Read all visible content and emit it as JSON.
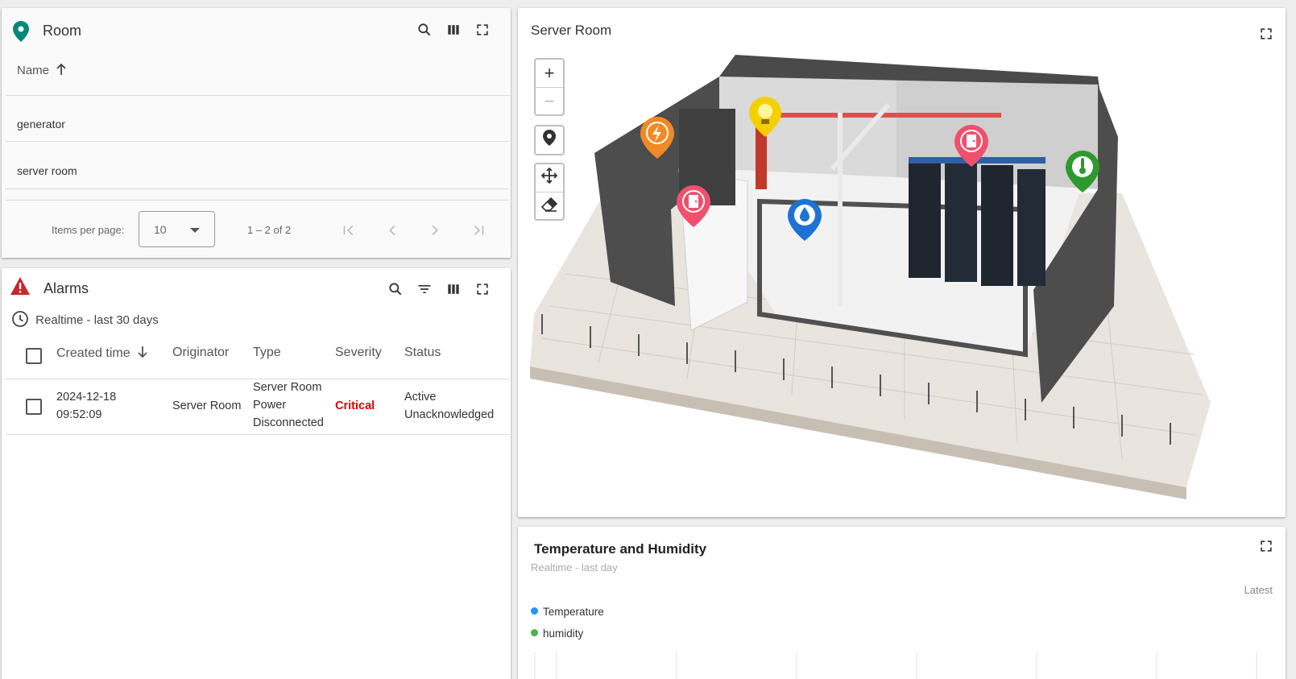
{
  "room": {
    "title": "Room",
    "column_header": "Name",
    "rows": [
      "generator",
      "server room"
    ],
    "pager": {
      "items_per_page_label": "Items per page:",
      "items_per_page_value": "10",
      "range_label": "1 – 2 of 2"
    }
  },
  "alarms": {
    "title": "Alarms",
    "timewindow": "Realtime - last 30 days",
    "columns": [
      "Created time",
      "Originator",
      "Type",
      "Severity",
      "Status"
    ],
    "rows": [
      {
        "created_date": "2024-12-18",
        "created_time": "09:52:09",
        "originator": "Server Room",
        "type_line1": "Server Room",
        "type_line2": "Power",
        "type_line3": "Disconnected",
        "severity": "Critical",
        "status_line1": "Active",
        "status_line2": "Unacknowledged"
      }
    ],
    "severity_color": "#e00000"
  },
  "server_room": {
    "title": "Server Room",
    "markers": [
      {
        "name": "power-marker",
        "color": "#f08a24",
        "icon": "lightning-icon"
      },
      {
        "name": "light-marker",
        "color": "#f5d000",
        "icon": "bulb-icon"
      },
      {
        "name": "door-marker-1",
        "color": "#f0506e",
        "icon": "door-icon"
      },
      {
        "name": "door-marker-2",
        "color": "#f0506e",
        "icon": "door-icon"
      },
      {
        "name": "water-marker",
        "color": "#1e73d2",
        "icon": "water-drop-icon"
      },
      {
        "name": "temperature-marker",
        "color": "#2e9a2e",
        "icon": "thermometer-icon"
      }
    ]
  },
  "temp_humidity": {
    "title": "Temperature and Humidity",
    "timewindow": "Realtime - last day",
    "latest_label": "Latest",
    "legend": [
      {
        "label": "Temperature",
        "color": "#2196f3"
      },
      {
        "label": "humidity",
        "color": "#4caf50"
      }
    ]
  },
  "colors": {
    "accent_teal": "#00897b",
    "alarm_red": "#c62828"
  }
}
